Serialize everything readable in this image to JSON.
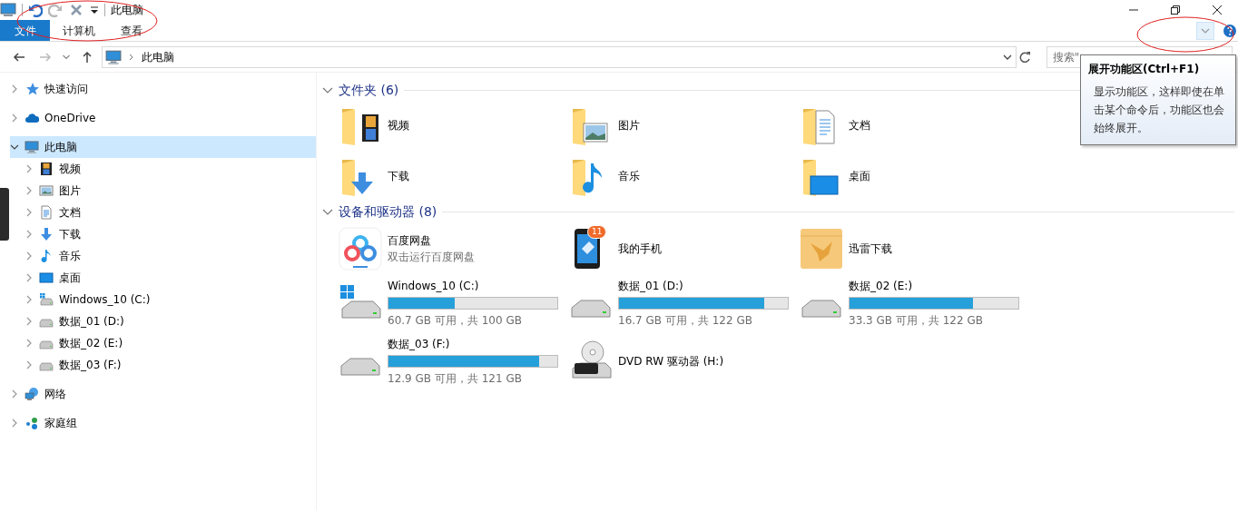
{
  "window": {
    "title": "此电脑"
  },
  "ribbon_tabs": [
    {
      "label": "文件",
      "selected": true
    },
    {
      "label": "计算机",
      "selected": false
    },
    {
      "label": "查看",
      "selected": false
    }
  ],
  "address": {
    "path": "此电脑"
  },
  "search": {
    "placeholder": "搜索\""
  },
  "tooltip": {
    "title": "展开功能区(Ctrl+F1)",
    "text": "显示功能区，这样即使在单击某个命令后，功能区也会始终展开。"
  },
  "sidebar": {
    "items": [
      {
        "label": "快速访问",
        "kind": "star",
        "expanded": false,
        "selected": false
      },
      {
        "label": "OneDrive",
        "kind": "cloud",
        "expanded": false,
        "selected": false
      },
      {
        "label": "此电脑",
        "kind": "pc",
        "expanded": true,
        "selected": true,
        "children": [
          {
            "label": "视频",
            "kind": "video",
            "expanded": false,
            "selected": false
          },
          {
            "label": "图片",
            "kind": "picture",
            "expanded": false,
            "selected": false
          },
          {
            "label": "文档",
            "kind": "document",
            "expanded": false,
            "selected": false
          },
          {
            "label": "下载",
            "kind": "download",
            "expanded": false,
            "selected": false
          },
          {
            "label": "音乐",
            "kind": "music",
            "expanded": false,
            "selected": false
          },
          {
            "label": "桌面",
            "kind": "desktop",
            "expanded": false,
            "selected": false
          },
          {
            "label": "Windows_10 (C:)",
            "kind": "system-drive",
            "expanded": false,
            "selected": false
          },
          {
            "label": "数据_01 (D:)",
            "kind": "drive",
            "expanded": false,
            "selected": false
          },
          {
            "label": "数据_02 (E:)",
            "kind": "drive",
            "expanded": false,
            "selected": false
          },
          {
            "label": "数据_03 (F:)",
            "kind": "drive",
            "expanded": false,
            "selected": false
          }
        ]
      },
      {
        "label": "网络",
        "kind": "network",
        "expanded": false,
        "selected": false
      },
      {
        "label": "家庭组",
        "kind": "homegroup",
        "expanded": false,
        "selected": false
      }
    ]
  },
  "sections": [
    {
      "title": "文件夹 (6)",
      "expanded": true,
      "items": [
        {
          "kind": "video",
          "label": "视频"
        },
        {
          "kind": "picture",
          "label": "图片"
        },
        {
          "kind": "document",
          "label": "文档"
        },
        {
          "kind": "download",
          "label": "下载"
        },
        {
          "kind": "music",
          "label": "音乐"
        },
        {
          "kind": "desktop",
          "label": "桌面"
        }
      ]
    },
    {
      "title": "设备和驱动器 (8)",
      "expanded": true,
      "items": [
        {
          "kind": "cloud-app",
          "label": "百度网盘",
          "subtitle": "双击运行百度网盘"
        },
        {
          "kind": "phone",
          "label": "我的手机",
          "badge": "11"
        },
        {
          "kind": "bird-folder",
          "label": "迅雷下载"
        },
        {
          "kind": "system-drive",
          "label": "Windows_10 (C:)",
          "level": 0.39,
          "reading": "60.7 GB 可用，共 100 GB"
        },
        {
          "kind": "drive",
          "label": "数据_01 (D:)",
          "level": 0.86,
          "reading": "16.7 GB 可用，共 122 GB"
        },
        {
          "kind": "drive",
          "label": "数据_02 (E:)",
          "level": 0.73,
          "reading": "33.3 GB 可用，共 122 GB"
        },
        {
          "kind": "drive",
          "label": "数据_03 (F:)",
          "level": 0.89,
          "reading": "12.9 GB 可用，共 121 GB"
        },
        {
          "kind": "dvd",
          "label": "DVD RW 驱动器 (H:)"
        }
      ]
    }
  ]
}
